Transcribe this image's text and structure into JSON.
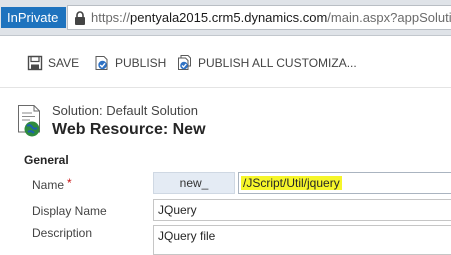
{
  "browser": {
    "inprivate_label": "InPrivate",
    "url_scheme": "https://",
    "url_host": "pentyala2015.crm5.dynamics.com",
    "url_path": "/main.aspx?appSolutionId="
  },
  "toolbar": {
    "save_label": "SAVE",
    "publish_label": "PUBLISH",
    "publish_all_label": "PUBLISH ALL CUSTOMIZA..."
  },
  "header": {
    "subtitle": "Solution: Default Solution",
    "title": "Web Resource: New"
  },
  "form": {
    "section_title": "General",
    "name": {
      "label": "Name",
      "required_marker": "*",
      "prefix": "new_",
      "value": "/JScript/Util/jquery"
    },
    "display_name": {
      "label": "Display Name",
      "value": "JQuery"
    },
    "description": {
      "label": "Description",
      "value": "JQuery file"
    }
  },
  "colors": {
    "inprivate_bg": "#1e73be",
    "highlight": "#f6f62a",
    "required": "#c81414",
    "prefix_bg": "#e4ebf4"
  }
}
